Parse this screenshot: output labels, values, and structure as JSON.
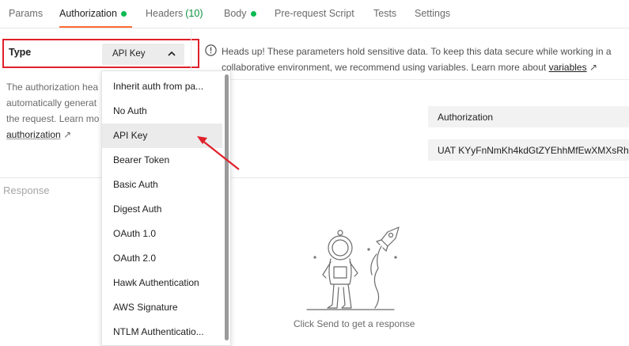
{
  "tabs": [
    {
      "label": "Params"
    },
    {
      "label": "Authorization"
    },
    {
      "label": "Headers",
      "count": "(10)"
    },
    {
      "label": "Body"
    },
    {
      "label": "Pre-request Script"
    },
    {
      "label": "Tests"
    },
    {
      "label": "Settings"
    }
  ],
  "auth": {
    "type_label": "Type",
    "selected": "API Key",
    "desc_lines": [
      "The authorization hea",
      "automatically generat",
      "the request. Learn mo"
    ],
    "desc_link": "authorization",
    "desc_link_arrow": "↗"
  },
  "heads_up": {
    "line1": "Heads up! These parameters hold sensitive data. To keep this data secure while working in a",
    "line2": "collaborative environment, we recommend using variables. Learn more about ",
    "link": "variables",
    "link_arrow": "↗"
  },
  "fields": {
    "key": "Authorization",
    "value": "UAT KYyFnNmKh4kdGtZYEhhMfEwXMXsRh"
  },
  "response": {
    "label": "Response",
    "empty_message": "Click Send to get a response"
  },
  "dropdown": {
    "items": [
      "Inherit auth from pa...",
      "No Auth",
      "API Key",
      "Bearer Token",
      "Basic Auth",
      "Digest Auth",
      "OAuth 1.0",
      "OAuth 2.0",
      "Hawk Authentication",
      "AWS Signature",
      "NTLM Authenticatio..."
    ]
  },
  "colors": {
    "accent": "#ff6c37",
    "status_dot": "#0cbb52",
    "highlight_box": "#e0202a"
  }
}
